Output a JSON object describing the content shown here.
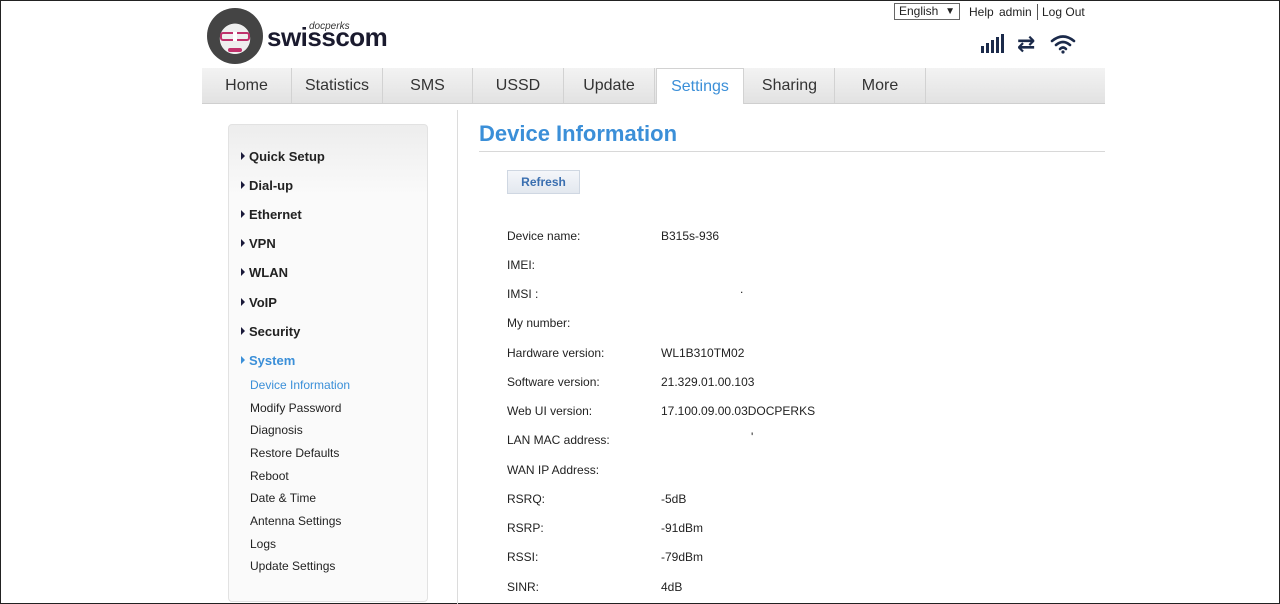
{
  "header": {
    "logo_word": "swisscom",
    "logo_sup": "docperks",
    "language": "English",
    "help": "Help",
    "user": "admin",
    "logout": "Log Out"
  },
  "nav": [
    "Home",
    "Statistics",
    "SMS",
    "USSD",
    "Update",
    "Settings",
    "Sharing",
    "More"
  ],
  "nav_active": "Settings",
  "sidebar": {
    "menus": [
      "Quick Setup",
      "Dial-up",
      "Ethernet",
      "VPN",
      "WLAN",
      "VoIP",
      "Security",
      "System"
    ],
    "active_menu": "System",
    "submenu": [
      "Device Information",
      "Modify Password",
      "Diagnosis",
      "Restore Defaults",
      "Reboot",
      "Date & Time",
      "Antenna Settings",
      "Logs",
      "Update Settings"
    ],
    "active_submenu": "Device Information"
  },
  "content": {
    "title": "Device Information",
    "refresh": "Refresh",
    "rows": [
      {
        "label": "Device name:",
        "value": "B315s-936"
      },
      {
        "label": "IMEI:",
        "value": ""
      },
      {
        "label": "IMSI :",
        "value": "."
      },
      {
        "label": "My number:",
        "value": ""
      },
      {
        "label": "Hardware version:",
        "value": "WL1B310TM02"
      },
      {
        "label": "Software version:",
        "value": "21.329.01.00.103"
      },
      {
        "label": "Web UI version:",
        "value": "17.100.09.00.03DOCPERKS"
      },
      {
        "label": "LAN MAC address:",
        "value": "'"
      },
      {
        "label": "WAN IP Address:",
        "value": ""
      },
      {
        "label": "RSRQ:",
        "value": "-5dB"
      },
      {
        "label": "RSRP:",
        "value": "-91dBm"
      },
      {
        "label": "RSSI:",
        "value": "-79dBm"
      },
      {
        "label": "SINR:",
        "value": "4dB"
      }
    ]
  },
  "colors": {
    "accent": "#3b8fd8",
    "icon": "#1b2a4a"
  },
  "icons": [
    "signal-strength-icon",
    "data-transfer-icon",
    "wifi-icon",
    "dropdown-arrow-icon",
    "menu-triangle-icon"
  ]
}
